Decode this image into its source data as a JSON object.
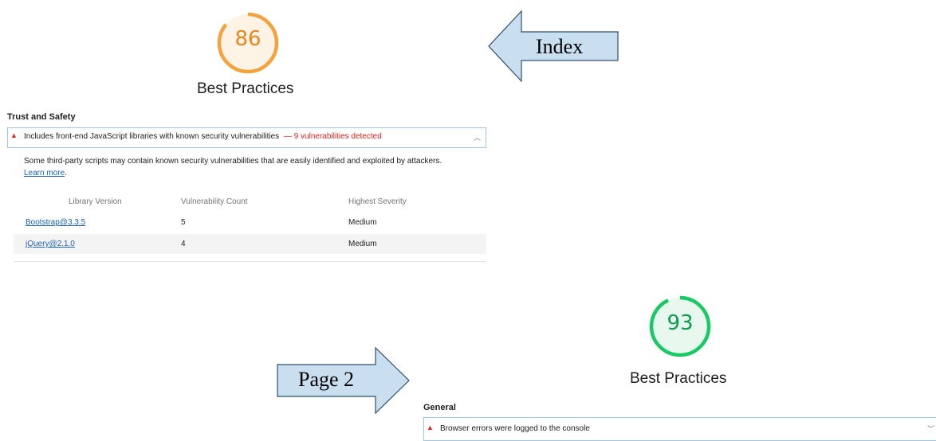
{
  "gauge_index": {
    "score": "86",
    "fraction": 0.86,
    "color": "#f4a23c",
    "bg": "#fff3e6",
    "title": "Best Practices"
  },
  "gauge_page2": {
    "score": "93",
    "fraction": 0.93,
    "color": "#18c964",
    "bg": "#e8f8ef",
    "title": "Best Practices"
  },
  "arrows": {
    "index_label": "Index",
    "page2_label": "Page 2",
    "fill": "#c9dff0",
    "stroke": "#2f4f6e"
  },
  "trust": {
    "section_title": "Trust and Safety",
    "audit_text": "Includes front-end JavaScript libraries with known security vulnerabilities",
    "audit_detail": "— 9 vulnerabilities detected",
    "description": "Some third-party scripts may contain known security vulnerabilities that are easily identified and exploited by attackers.",
    "learn_more": "Learn more",
    "period": ".",
    "columns": [
      "Library Version",
      "Vulnerability Count",
      "Highest Severity"
    ],
    "rows": [
      {
        "library": "Bootstrap@3.3.5",
        "count": "5",
        "severity": "Medium"
      },
      {
        "library": "jQuery@2.1.0",
        "count": "4",
        "severity": "Medium"
      }
    ]
  },
  "general": {
    "section_title": "General",
    "audit_text": "Browser errors were logged to the console"
  },
  "icons": {
    "warning": "warning-triangle-icon",
    "chevron_up": "chevron-up-icon",
    "chevron_down": "chevron-down-icon"
  }
}
